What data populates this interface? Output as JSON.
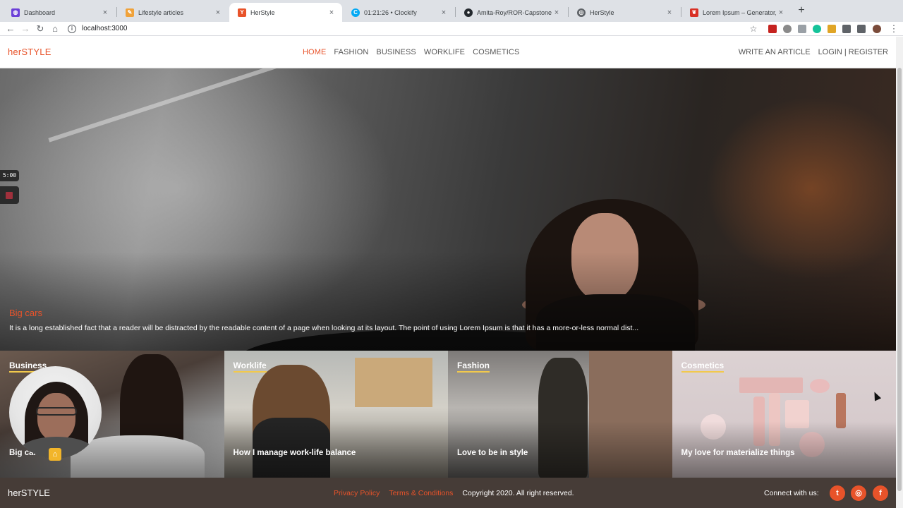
{
  "browser": {
    "tabs": [
      {
        "title": "Dashboard",
        "favicon_color": "#6b3fd8",
        "favicon_glyph": "◍",
        "active": false
      },
      {
        "title": "Lifestyle articles",
        "favicon_color": "#f0a23a",
        "favicon_glyph": "✎",
        "active": false
      },
      {
        "title": "HerStyle",
        "favicon_color": "#e8532a",
        "favicon_glyph": "Y",
        "active": true
      },
      {
        "title": "01:21:26 • Clockify",
        "favicon_color": "#03a9f4",
        "favicon_glyph": "C",
        "active": false
      },
      {
        "title": "Amita-Roy/ROR-Capstone-Her",
        "favicon_color": "#24292e",
        "favicon_glyph": "●",
        "active": false
      },
      {
        "title": "HerStyle",
        "favicon_color": "#5f6368",
        "favicon_glyph": "◎",
        "active": false
      },
      {
        "title": "Lorem Ipsum – Generator, Orig",
        "favicon_color": "#d93025",
        "favicon_glyph": "❦",
        "active": false
      }
    ],
    "new_tab": "+",
    "close_glyph": "×",
    "url": "localhost:3000",
    "icons": [
      "back-icon",
      "forward-icon",
      "reload-icon",
      "home-icon",
      "site-info-icon",
      "star-icon",
      "extensions-icon",
      "profile-avatar-icon",
      "kebab-menu-icon"
    ]
  },
  "site": {
    "brand": "herSTYLE",
    "nav": [
      "HOME",
      "FASHION",
      "BUSINESS",
      "WORKLIFE",
      "COSMETICS"
    ],
    "active_nav": "HOME",
    "write_article": "WRITE AN ARTICLE",
    "login_register": "LOGIN | REGISTER"
  },
  "hero": {
    "title": "Big cars",
    "text": "It is a long established fact that a reader will be distracted by the readable content of a page when looking at its layout. The point of using Lorem Ipsum is that it has a more-or-less normal dist..."
  },
  "recorder": {
    "timer": "5:00"
  },
  "categories": [
    {
      "name": "Business",
      "article": "Big cars"
    },
    {
      "name": "Worklife",
      "article": "How I manage work-life balance"
    },
    {
      "name": "Fashion",
      "article": "Love to be in style"
    },
    {
      "name": "Cosmetics",
      "article": "My love for materialize things"
    }
  ],
  "footer": {
    "brand": "herSTYLE",
    "privacy": "Privacy Policy",
    "terms": "Terms & Conditions",
    "copyright": "Copyright 2020. All right reserved.",
    "connect": "Connect with us:",
    "social": [
      {
        "name": "twitter",
        "glyph": "t"
      },
      {
        "name": "instagram",
        "glyph": "◎"
      },
      {
        "name": "facebook",
        "glyph": "f"
      }
    ]
  },
  "colors": {
    "accent": "#e8532a",
    "footer_bg": "#463c37",
    "underline": "#f2c94c"
  }
}
